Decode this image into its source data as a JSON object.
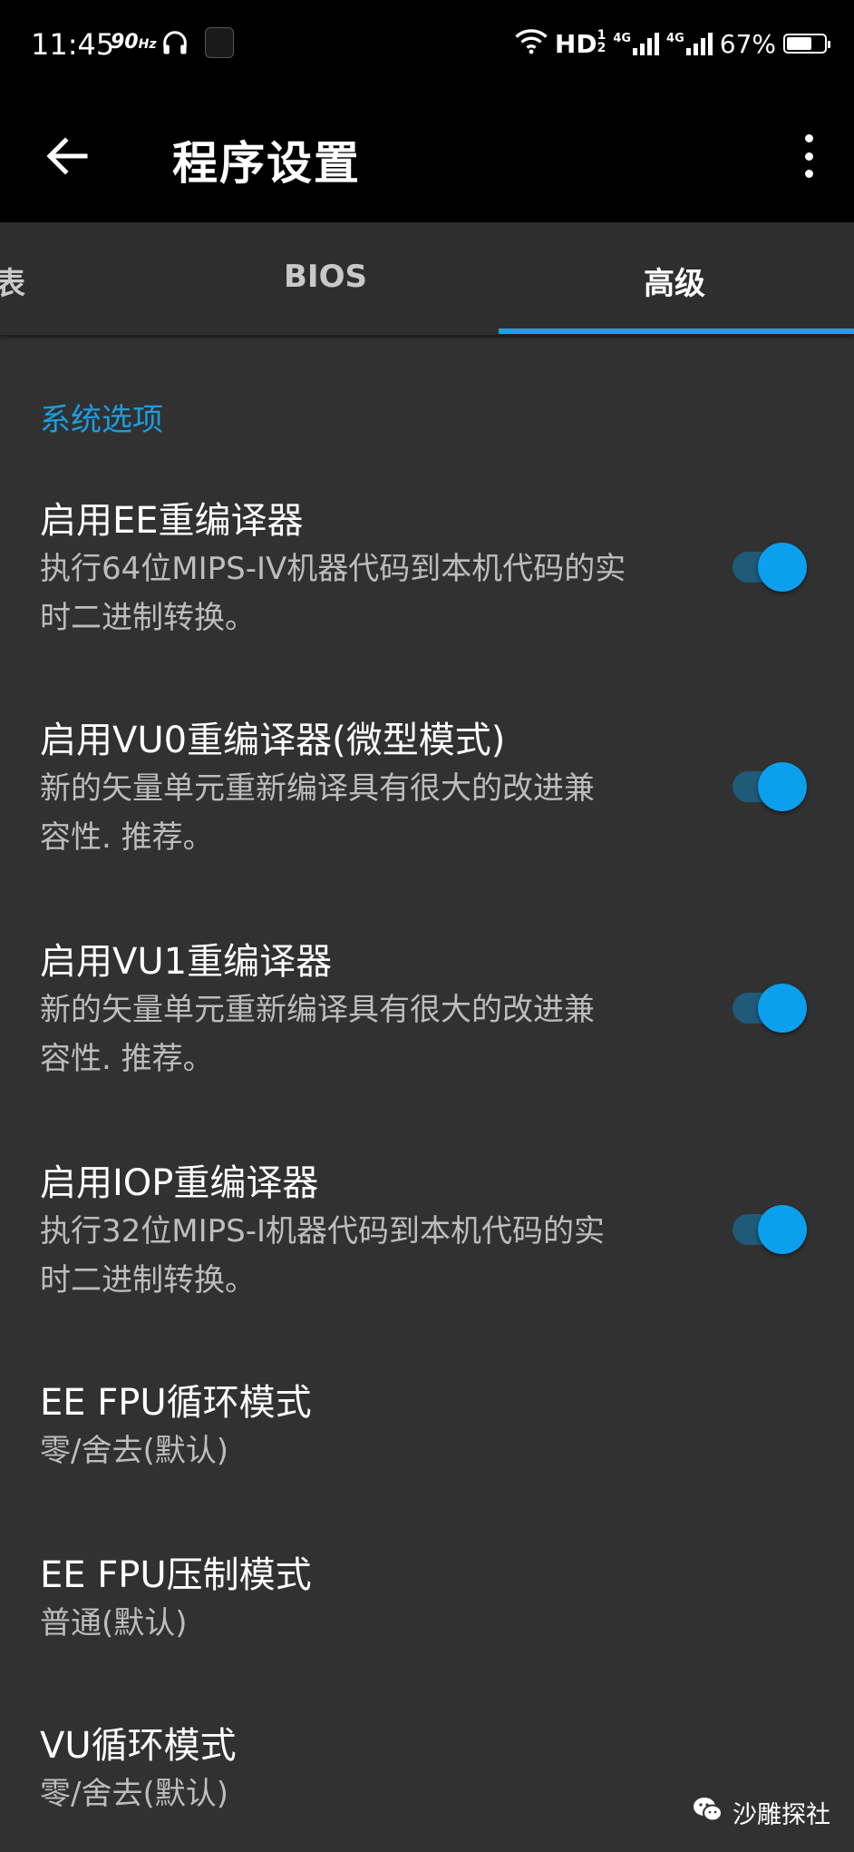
{
  "status_bar": {
    "time": "11:45",
    "refresh_rate": "90",
    "refresh_unit": "Hz",
    "network": "HD",
    "network_sup": "1",
    "network_sub": "2",
    "sig1_label": "4G",
    "sig2_label": "4G",
    "battery_text": "67%",
    "battery_level": 0.67,
    "icons": [
      "headphone-icon",
      "app-icon",
      "wifi-icon",
      "signal-icon",
      "battery-icon"
    ]
  },
  "app_bar": {
    "title": "程序设置",
    "back_icon": "arrow-back-icon",
    "menu_icon": "more-vert-icon"
  },
  "tabs": [
    {
      "label": "表"
    },
    {
      "label": "BIOS"
    },
    {
      "label": "高级",
      "active": true
    }
  ],
  "section": {
    "title": "系统选项"
  },
  "settings": [
    {
      "title": "启用EE重编译器",
      "summary_l1": "执行64位MIPS-IV机器代码到本机代码的实",
      "summary_l2": "时二进制转换。",
      "checked": true
    },
    {
      "title": "启用VU0重编译器(微型模式)",
      "summary_l1": "新的矢量单元重新编译具有很大的改进兼",
      "summary_l2": "容性. 推荐。",
      "checked": true
    },
    {
      "title": "启用VU1重编译器",
      "summary_l1": "新的矢量单元重新编译具有很大的改进兼",
      "summary_l2": "容性. 推荐。",
      "checked": true
    },
    {
      "title": "启用IOP重编译器",
      "summary_l1": "执行32位MIPS-I机器代码到本机代码的实",
      "summary_l2": "时二进制转换。",
      "checked": true
    },
    {
      "title": "EE FPU循环模式",
      "value": "零/舍去(默认)"
    },
    {
      "title": "EE FPU压制模式",
      "value": "普通(默认)"
    },
    {
      "title": "VU循环模式",
      "value": "零/舍去(默认)"
    }
  ],
  "watermark": {
    "text": "沙雕探社"
  },
  "colors": {
    "accent": "#1ea0e6",
    "background": "#313131",
    "toggle_thumb": "#0aa0ee",
    "toggle_track": "#1f5a78"
  }
}
